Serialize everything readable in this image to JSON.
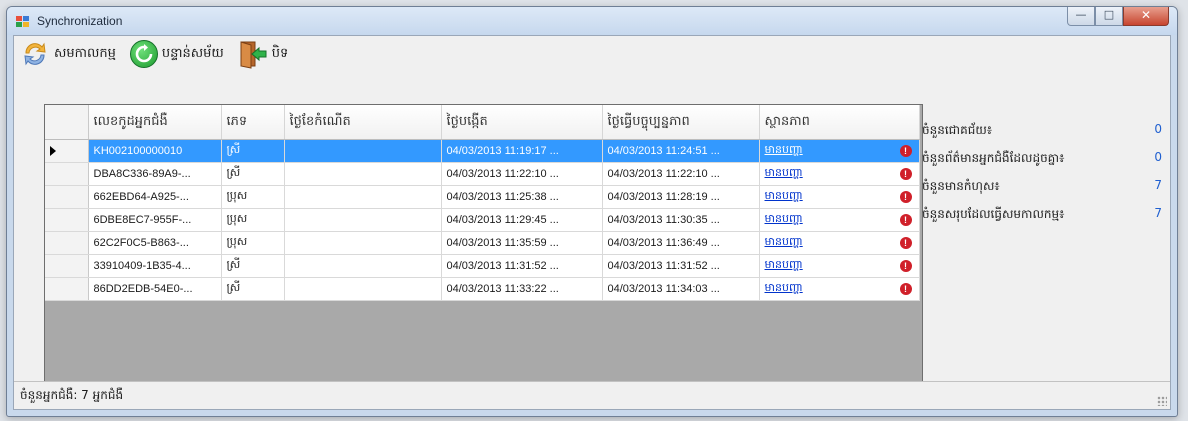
{
  "window": {
    "title": "Synchronization"
  },
  "toolbar": {
    "sync_label": "សមកាលកម្ម",
    "refresh_label": "បន្ទាន់សម័យ",
    "close_label": "បិទ"
  },
  "grid": {
    "columns": [
      "លេខកូដអ្នកជំងឺ",
      "ភេទ",
      "ថ្ងៃខែកំណើត",
      "ថ្ងៃបង្កើត",
      "ថ្ងៃធ្វើបច្ចុប្បន្នភាព",
      "ស្ថានភាព"
    ],
    "rows": [
      [
        "KH002100000010",
        "ស្រី",
        "",
        "04/03/2013 11:19:17 ...",
        "04/03/2013 11:24:51 ...",
        "មានបញ្ហា"
      ],
      [
        "DBA8C336-89A9-...",
        "ស្រី",
        "",
        "04/03/2013 11:22:10 ...",
        "04/03/2013 11:22:10 ...",
        "មានបញ្ហា"
      ],
      [
        "662EBD64-A925-...",
        "ប្រុស",
        "",
        "04/03/2013 11:25:38 ...",
        "04/03/2013 11:28:19 ...",
        "មានបញ្ហា"
      ],
      [
        "6DBE8EC7-955F-...",
        "ប្រុស",
        "",
        "04/03/2013 11:29:45 ...",
        "04/03/2013 11:30:35 ...",
        "មានបញ្ហា"
      ],
      [
        "62C2F0C5-B863-...",
        "ប្រុស",
        "",
        "04/03/2013 11:35:59 ...",
        "04/03/2013 11:36:49 ...",
        "មានបញ្ហា"
      ],
      [
        "33910409-1B35-4...",
        "ស្រី",
        "",
        "04/03/2013 11:31:52 ...",
        "04/03/2013 11:31:52 ...",
        "មានបញ្ហា"
      ],
      [
        "86DD2EDB-54E0-...",
        "ស្រី",
        "",
        "04/03/2013 11:33:22 ...",
        "04/03/2013 11:34:03 ...",
        "មានបញ្ហា"
      ]
    ],
    "selected_row": 0
  },
  "stats": [
    {
      "label": "ចំនួនជោគជ័យ៖",
      "value": "0"
    },
    {
      "label": "ចំនួនព័ត៌មានអ្នកជំងឺដែលដូចគ្នា៖",
      "value": "0"
    },
    {
      "label": "ចំនួនមានកំហុស៖",
      "value": "7"
    },
    {
      "label": "ចំនួនសរុបដែលធ្វើសមកាលកម្ម៖",
      "value": "7"
    }
  ],
  "statusbar": {
    "patient_count": "ចំនួនអ្នកជំងឺ:  7 អ្នកជំងឺ"
  },
  "colors": {
    "selection": "#3399ff",
    "link": "#0033cc",
    "error": "#d0202a",
    "stat_value": "#1f5fd0"
  }
}
